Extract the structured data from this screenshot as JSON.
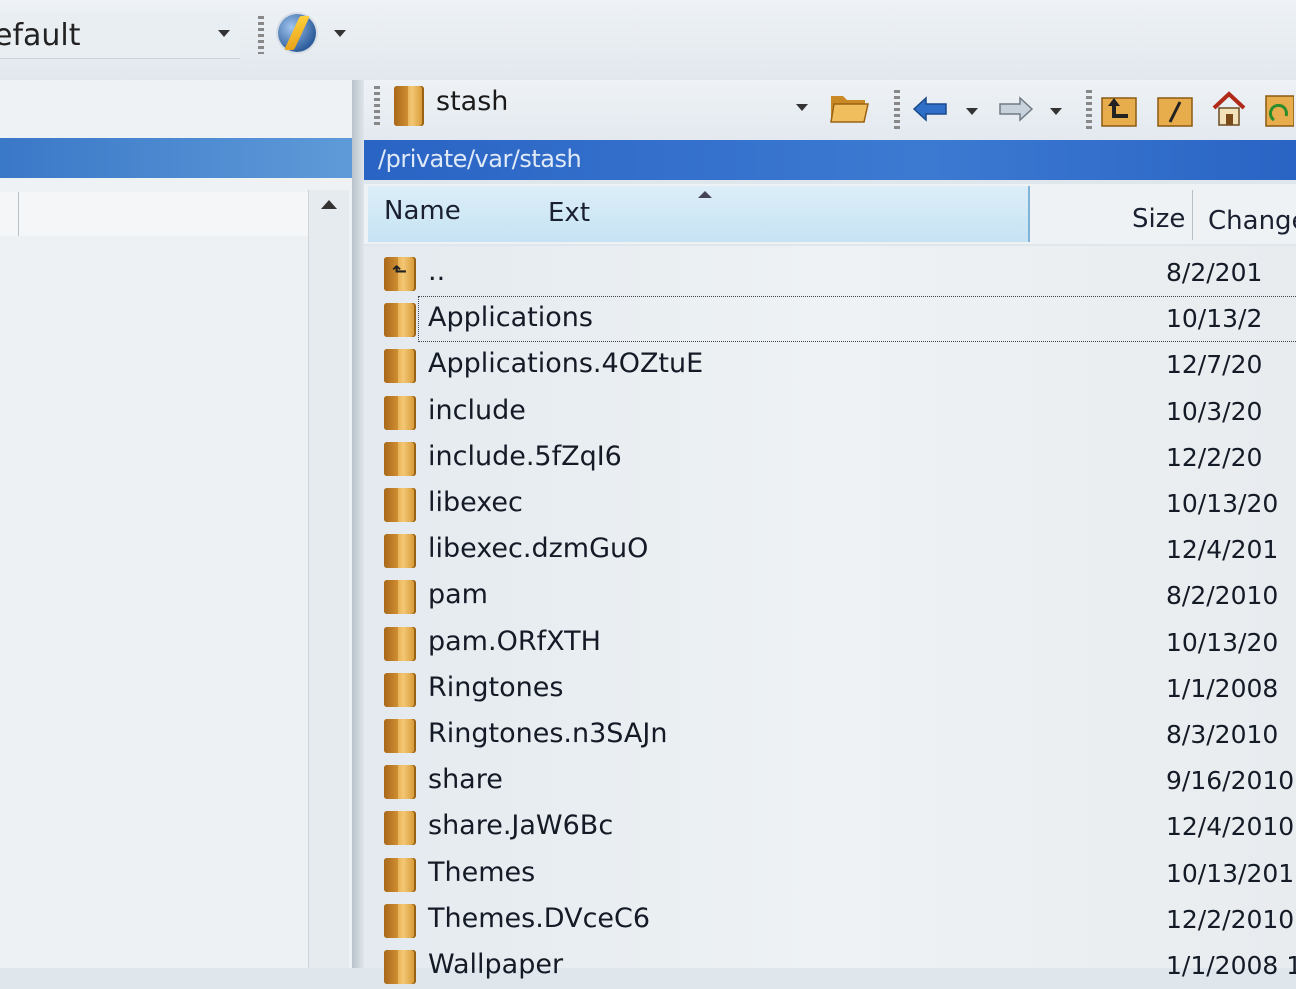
{
  "session": {
    "current": "efault"
  },
  "drive": {
    "name": "stash"
  },
  "path": "/private/var/stash",
  "columns": {
    "name": "Name",
    "ext": "Ext",
    "size": "Size",
    "changed": "Change"
  },
  "files": [
    {
      "name": "..",
      "date": "8/2/201"
    },
    {
      "name": "Applications",
      "date": "10/13/2"
    },
    {
      "name": "Applications.4OZtuE",
      "date": "12/7/20"
    },
    {
      "name": "include",
      "date": "10/3/20"
    },
    {
      "name": "include.5fZqI6",
      "date": "12/2/20"
    },
    {
      "name": "libexec",
      "date": "10/13/20"
    },
    {
      "name": "libexec.dzmGuO",
      "date": "12/4/201"
    },
    {
      "name": "pam",
      "date": "8/2/2010"
    },
    {
      "name": "pam.ORfXTH",
      "date": "10/13/20"
    },
    {
      "name": "Ringtones",
      "date": "1/1/2008"
    },
    {
      "name": "Ringtones.n3SAJn",
      "date": "8/3/2010"
    },
    {
      "name": "share",
      "date": "9/16/2010"
    },
    {
      "name": "share.JaW6Bc",
      "date": "12/4/2010"
    },
    {
      "name": "Themes",
      "date": "10/13/201"
    },
    {
      "name": "Themes.DVceC6",
      "date": "12/2/2010"
    },
    {
      "name": "Wallpaper",
      "date": "1/1/2008 1"
    }
  ],
  "icons": {
    "session_menu": "globe-lightning-icon",
    "open_folder": "open-folder-icon",
    "back": "arrow-left-icon",
    "forward": "arrow-right-icon",
    "parent": "parent-folder-icon",
    "root": "root-folder-icon",
    "home": "home-icon",
    "refresh": "refresh-icon"
  }
}
